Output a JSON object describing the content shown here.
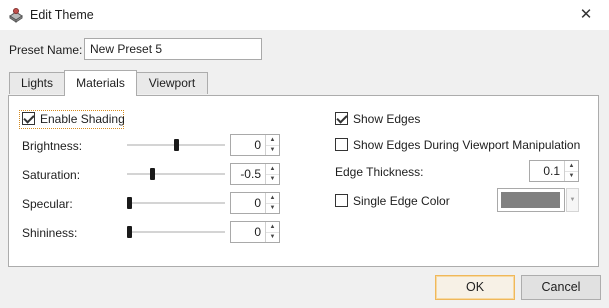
{
  "window": {
    "title": "Edit Theme",
    "close_glyph": "✕",
    "icon": "theme-app-icon"
  },
  "preset": {
    "label": "Preset Name:",
    "value": "New Preset 5"
  },
  "tabs": [
    {
      "label": "Lights",
      "active": false
    },
    {
      "label": "Materials",
      "active": true
    },
    {
      "label": "Viewport",
      "active": false
    }
  ],
  "materials": {
    "enable_shading": {
      "label": "Enable Shading",
      "checked": true
    },
    "sliders": [
      {
        "label": "Brightness:",
        "value": "0",
        "fraction": 0.5
      },
      {
        "label": "Saturation:",
        "value": "-0.5",
        "fraction": 0.25
      },
      {
        "label": "Specular:",
        "value": "0",
        "fraction": 0.0
      },
      {
        "label": "Shininess:",
        "value": "0",
        "fraction": 0.0
      }
    ],
    "show_edges": {
      "label": "Show Edges",
      "checked": true
    },
    "show_edges_manip": {
      "label": "Show Edges During Viewport Manipulation",
      "checked": false
    },
    "edge_thickness": {
      "label": "Edge Thickness:",
      "value": "0.1"
    },
    "single_edge_color": {
      "label": "Single Edge Color",
      "checked": false,
      "color": "#808080"
    }
  },
  "buttons": {
    "ok": "OK",
    "cancel": "Cancel"
  },
  "spinner_glyphs": {
    "up": "▲",
    "down": "▼"
  }
}
